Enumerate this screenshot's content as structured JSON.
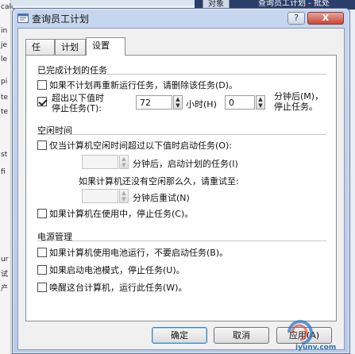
{
  "background": {
    "left_fragments": [
      "calc",
      "in",
      "je",
      "le",
      "pi",
      "te",
      "te",
      "st",
      "fi",
      "ur",
      "试",
      "产"
    ],
    "top_tab": "对象",
    "top_title": "查询员工计划 - 批处"
  },
  "window": {
    "title": "查询员工计划",
    "help_label": "?",
    "close_label": "X"
  },
  "tabs": [
    {
      "label": "任务"
    },
    {
      "label": "计划"
    },
    {
      "label": "设置"
    }
  ],
  "completed": {
    "heading": "已完成计划的任务",
    "delete_if_not_rescheduled": "如果不计划再重新运行任务，请删除该任务(D)。",
    "stop_after_label_1": "超出以下值时",
    "stop_after_label_2": "停止任务(T):",
    "hours_value": "72",
    "hours_unit": "小时(H)",
    "minutes_value": "0",
    "minutes_unit_1": "分钟后(M)，",
    "minutes_unit_2": "停止任务。"
  },
  "idle": {
    "heading": "空闲时间",
    "start_if_idle": "仅当计算机空闲时间超过以下值时启动任务(O):",
    "idle_minutes_label": "分钟后，启动计划的任务(I)",
    "retry_intro": "如果计算机还没有空闲那么久，请重试至:",
    "retry_minutes_label": "分钟后重试(N)",
    "stop_if_in_use": "如果计算机在使用中，停止任务(C)。"
  },
  "power": {
    "heading": "电源管理",
    "no_start_on_battery": "如果计算机使用电池运行，不要启动任务(B)。",
    "stop_on_battery": "如果启动电池模式，停止任务(U)。",
    "wake_to_run": "唤醒这台计算机，运行此任务(W)。"
  },
  "buttons": {
    "ok": "确定",
    "cancel": "取消",
    "apply": "应用(A)"
  },
  "watermark": "iyunv.com"
}
